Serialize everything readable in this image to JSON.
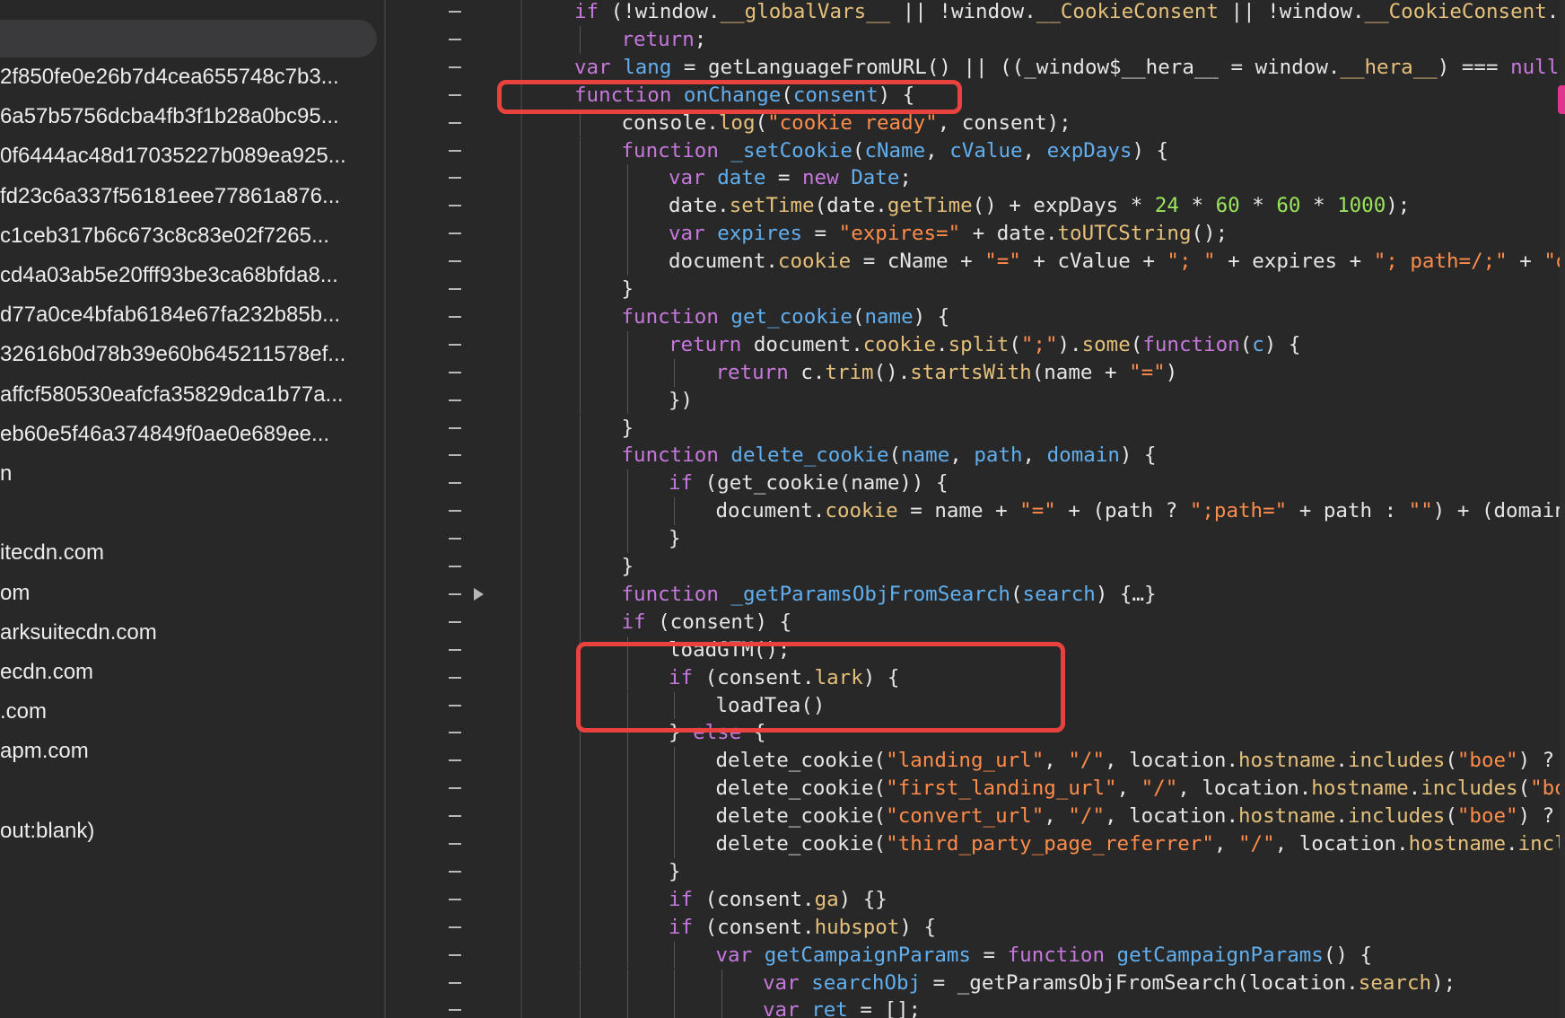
{
  "sidebar": {
    "items": [
      "2f850fe0e26b7d4cea655748c7b3...",
      "6a57b5756dcba4fb3f1b28a0bc95...",
      "0f6444ac48d17035227b089ea925...",
      "fd23c6a337f56181eee77861a876...",
      "c1ceb317b6c673c8c83e02f7265...",
      "cd4a03ab5e20fff93be3ca68bfda8...",
      "d77a0ce4bfab6184e67fa232b85b...",
      "32616b0d78b39e60b645211578ef...",
      "affcf580530eafcfa35829dca1b77a...",
      "eb60e5f46a374849f0ae0e689ee...",
      "n",
      "",
      "itecdn.com",
      "om",
      "arksuitecdn.com",
      "ecdn.com",
      ".com",
      "apm.com",
      "",
      "out:blank)"
    ]
  },
  "theme": {
    "keyword": "#c678dd",
    "function_name": "#61afef",
    "property": "#e5c07b",
    "string": "#ff8c4b",
    "number": "#9ae65c",
    "plain": "#e6e6e6",
    "highlight_box": "#e8423f",
    "scroll_marker": "#e0358f"
  },
  "code_lines": [
    {
      "indent": 0,
      "tokens": [
        [
          "if",
          "k"
        ],
        [
          " (!window.",
          "p"
        ],
        [
          "__globalVars__",
          "y"
        ],
        [
          " || !window.",
          "p"
        ],
        [
          "__CookieConsent",
          "y"
        ],
        [
          " || !window.",
          "p"
        ],
        [
          "__CookieConsent",
          "y"
        ],
        [
          ".",
          "p"
        ],
        [
          "ir",
          "y"
        ]
      ]
    },
    {
      "indent": 1,
      "tokens": [
        [
          "return",
          "k"
        ],
        [
          ";",
          "p"
        ]
      ]
    },
    {
      "indent": 0,
      "tokens": [
        [
          "var",
          "k"
        ],
        [
          " ",
          "p"
        ],
        [
          "lang",
          "f"
        ],
        [
          " = getLanguageFromURL() || ((_window$__hera__ = window.",
          "p"
        ],
        [
          "__hera__",
          "y"
        ],
        [
          ") === ",
          "p"
        ],
        [
          "null",
          "k"
        ],
        [
          " |",
          "p"
        ]
      ]
    },
    {
      "indent": 0,
      "tokens": [
        [
          "function",
          "k"
        ],
        [
          " ",
          "p"
        ],
        [
          "onChange",
          "f"
        ],
        [
          "(",
          "p"
        ],
        [
          "consent",
          "f"
        ],
        [
          ") {",
          "p"
        ]
      ]
    },
    {
      "indent": 1,
      "tokens": [
        [
          "console.",
          "p"
        ],
        [
          "log",
          "y"
        ],
        [
          "(",
          "p"
        ],
        [
          "\"cookie ready\"",
          "s"
        ],
        [
          ", consent);",
          "p"
        ]
      ]
    },
    {
      "indent": 1,
      "tokens": [
        [
          "function",
          "k"
        ],
        [
          " ",
          "p"
        ],
        [
          "_setCookie",
          "f"
        ],
        [
          "(",
          "p"
        ],
        [
          "cName",
          "f"
        ],
        [
          ", ",
          "p"
        ],
        [
          "cValue",
          "f"
        ],
        [
          ", ",
          "p"
        ],
        [
          "expDays",
          "f"
        ],
        [
          ") {",
          "p"
        ]
      ]
    },
    {
      "indent": 2,
      "tokens": [
        [
          "var",
          "k"
        ],
        [
          " ",
          "p"
        ],
        [
          "date",
          "f"
        ],
        [
          " = ",
          "p"
        ],
        [
          "new",
          "k"
        ],
        [
          " ",
          "p"
        ],
        [
          "Date",
          "f"
        ],
        [
          ";",
          "p"
        ]
      ]
    },
    {
      "indent": 2,
      "tokens": [
        [
          "date.",
          "p"
        ],
        [
          "setTime",
          "y"
        ],
        [
          "(date.",
          "p"
        ],
        [
          "getTime",
          "y"
        ],
        [
          "() + expDays * ",
          "p"
        ],
        [
          "24",
          "n"
        ],
        [
          " * ",
          "p"
        ],
        [
          "60",
          "n"
        ],
        [
          " * ",
          "p"
        ],
        [
          "60",
          "n"
        ],
        [
          " * ",
          "p"
        ],
        [
          "1000",
          "n"
        ],
        [
          ");",
          "p"
        ]
      ]
    },
    {
      "indent": 2,
      "tokens": [
        [
          "var",
          "k"
        ],
        [
          " ",
          "p"
        ],
        [
          "expires",
          "f"
        ],
        [
          " = ",
          "p"
        ],
        [
          "\"expires=\"",
          "s"
        ],
        [
          " + date.",
          "p"
        ],
        [
          "toUTCString",
          "y"
        ],
        [
          "();",
          "p"
        ]
      ]
    },
    {
      "indent": 2,
      "tokens": [
        [
          "document.",
          "p"
        ],
        [
          "cookie",
          "y"
        ],
        [
          " = cName + ",
          "p"
        ],
        [
          "\"=\"",
          "s"
        ],
        [
          " + cValue + ",
          "p"
        ],
        [
          "\"; \"",
          "s"
        ],
        [
          " + expires + ",
          "p"
        ],
        [
          "\"; path=/;\"",
          "s"
        ],
        [
          " + ",
          "p"
        ],
        [
          "\"do",
          "s"
        ]
      ]
    },
    {
      "indent": 1,
      "tokens": [
        [
          "}",
          "p"
        ]
      ]
    },
    {
      "indent": 1,
      "tokens": [
        [
          "function",
          "k"
        ],
        [
          " ",
          "p"
        ],
        [
          "get_cookie",
          "f"
        ],
        [
          "(",
          "p"
        ],
        [
          "name",
          "f"
        ],
        [
          ") {",
          "p"
        ]
      ]
    },
    {
      "indent": 2,
      "tokens": [
        [
          "return",
          "k"
        ],
        [
          " document.",
          "p"
        ],
        [
          "cookie",
          "y"
        ],
        [
          ".",
          "p"
        ],
        [
          "split",
          "y"
        ],
        [
          "(",
          "p"
        ],
        [
          "\";\"",
          "s"
        ],
        [
          ").",
          "p"
        ],
        [
          "some",
          "y"
        ],
        [
          "(",
          "p"
        ],
        [
          "function",
          "k"
        ],
        [
          "(",
          "p"
        ],
        [
          "c",
          "f"
        ],
        [
          ") {",
          "p"
        ]
      ]
    },
    {
      "indent": 3,
      "tokens": [
        [
          "return",
          "k"
        ],
        [
          " c.",
          "p"
        ],
        [
          "trim",
          "y"
        ],
        [
          "().",
          "p"
        ],
        [
          "startsWith",
          "y"
        ],
        [
          "(name + ",
          "p"
        ],
        [
          "\"=\"",
          "s"
        ],
        [
          ")",
          "p"
        ]
      ]
    },
    {
      "indent": 2,
      "tokens": [
        [
          "})",
          "p"
        ]
      ]
    },
    {
      "indent": 1,
      "tokens": [
        [
          "}",
          "p"
        ]
      ]
    },
    {
      "indent": 1,
      "tokens": [
        [
          "function",
          "k"
        ],
        [
          " ",
          "p"
        ],
        [
          "delete_cookie",
          "f"
        ],
        [
          "(",
          "p"
        ],
        [
          "name",
          "f"
        ],
        [
          ", ",
          "p"
        ],
        [
          "path",
          "f"
        ],
        [
          ", ",
          "p"
        ],
        [
          "domain",
          "f"
        ],
        [
          ") {",
          "p"
        ]
      ]
    },
    {
      "indent": 2,
      "tokens": [
        [
          "if",
          "k"
        ],
        [
          " (get_cookie(name)) {",
          "p"
        ]
      ]
    },
    {
      "indent": 3,
      "tokens": [
        [
          "document.",
          "p"
        ],
        [
          "cookie",
          "y"
        ],
        [
          " = name + ",
          "p"
        ],
        [
          "\"=\"",
          "s"
        ],
        [
          " + (path ? ",
          "p"
        ],
        [
          "\";path=\"",
          "s"
        ],
        [
          " + path : ",
          "p"
        ],
        [
          "\"\"",
          "s"
        ],
        [
          ") + (domain",
          "p"
        ]
      ]
    },
    {
      "indent": 2,
      "tokens": [
        [
          "}",
          "p"
        ]
      ]
    },
    {
      "indent": 1,
      "tokens": [
        [
          "}",
          "p"
        ]
      ]
    },
    {
      "indent": 1,
      "fold": true,
      "tokens": [
        [
          "function",
          "k"
        ],
        [
          " ",
          "p"
        ],
        [
          "_getParamsObjFromSearch",
          "f"
        ],
        [
          "(",
          "p"
        ],
        [
          "search",
          "f"
        ],
        [
          ") {…}",
          "p"
        ]
      ]
    },
    {
      "indent": 1,
      "tokens": [
        [
          "if",
          "k"
        ],
        [
          " (consent) {",
          "p"
        ]
      ]
    },
    {
      "indent": 2,
      "tokens": [
        [
          "loadGTM();",
          "p"
        ]
      ]
    },
    {
      "indent": 2,
      "tokens": [
        [
          "if",
          "k"
        ],
        [
          " (consent.",
          "p"
        ],
        [
          "lark",
          "y"
        ],
        [
          ") {",
          "p"
        ]
      ]
    },
    {
      "indent": 3,
      "tokens": [
        [
          "loadTea()",
          "p"
        ]
      ]
    },
    {
      "indent": 2,
      "tokens": [
        [
          "} ",
          "p"
        ],
        [
          "else",
          "k"
        ],
        [
          " {",
          "p"
        ]
      ]
    },
    {
      "indent": 3,
      "tokens": [
        [
          "delete_cookie(",
          "p"
        ],
        [
          "\"landing_url\"",
          "s"
        ],
        [
          ", ",
          "p"
        ],
        [
          "\"/\"",
          "s"
        ],
        [
          ", location.",
          "p"
        ],
        [
          "hostname",
          "y"
        ],
        [
          ".",
          "p"
        ],
        [
          "includes",
          "y"
        ],
        [
          "(",
          "p"
        ],
        [
          "\"boe\"",
          "s"
        ],
        [
          ") ? ",
          "p"
        ],
        [
          "\"",
          "s"
        ]
      ]
    },
    {
      "indent": 3,
      "tokens": [
        [
          "delete_cookie(",
          "p"
        ],
        [
          "\"first_landing_url\"",
          "s"
        ],
        [
          ", ",
          "p"
        ],
        [
          "\"/\"",
          "s"
        ],
        [
          ", location.",
          "p"
        ],
        [
          "hostname",
          "y"
        ],
        [
          ".",
          "p"
        ],
        [
          "includes",
          "y"
        ],
        [
          "(",
          "p"
        ],
        [
          "\"boe",
          "s"
        ]
      ]
    },
    {
      "indent": 3,
      "tokens": [
        [
          "delete_cookie(",
          "p"
        ],
        [
          "\"convert_url\"",
          "s"
        ],
        [
          ", ",
          "p"
        ],
        [
          "\"/\"",
          "s"
        ],
        [
          ", location.",
          "p"
        ],
        [
          "hostname",
          "y"
        ],
        [
          ".",
          "p"
        ],
        [
          "includes",
          "y"
        ],
        [
          "(",
          "p"
        ],
        [
          "\"boe\"",
          "s"
        ],
        [
          ") ? ",
          "p"
        ],
        [
          "\"",
          "s"
        ]
      ]
    },
    {
      "indent": 3,
      "tokens": [
        [
          "delete_cookie(",
          "p"
        ],
        [
          "\"third_party_page_referrer\"",
          "s"
        ],
        [
          ", ",
          "p"
        ],
        [
          "\"/\"",
          "s"
        ],
        [
          ", location.",
          "p"
        ],
        [
          "hostname",
          "y"
        ],
        [
          ".",
          "p"
        ],
        [
          "inclu",
          "y"
        ]
      ]
    },
    {
      "indent": 2,
      "tokens": [
        [
          "}",
          "p"
        ]
      ]
    },
    {
      "indent": 2,
      "tokens": [
        [
          "if",
          "k"
        ],
        [
          " (consent.",
          "p"
        ],
        [
          "ga",
          "y"
        ],
        [
          ") {}",
          "p"
        ]
      ]
    },
    {
      "indent": 2,
      "tokens": [
        [
          "if",
          "k"
        ],
        [
          " (consent.",
          "p"
        ],
        [
          "hubspot",
          "y"
        ],
        [
          ") {",
          "p"
        ]
      ]
    },
    {
      "indent": 3,
      "tokens": [
        [
          "var",
          "k"
        ],
        [
          " ",
          "p"
        ],
        [
          "getCampaignParams",
          "f"
        ],
        [
          " = ",
          "p"
        ],
        [
          "function",
          "k"
        ],
        [
          " ",
          "p"
        ],
        [
          "getCampaignParams",
          "f"
        ],
        [
          "() {",
          "p"
        ]
      ]
    },
    {
      "indent": 4,
      "tokens": [
        [
          "var",
          "k"
        ],
        [
          " ",
          "p"
        ],
        [
          "searchObj",
          "f"
        ],
        [
          " = _getParamsObjFromSearch(location.",
          "p"
        ],
        [
          "search",
          "y"
        ],
        [
          ");",
          "p"
        ]
      ]
    },
    {
      "indent": 4,
      "tokens": [
        [
          "var",
          "k"
        ],
        [
          " ",
          "p"
        ],
        [
          "ret",
          "f"
        ],
        [
          " = [];",
          "p"
        ]
      ]
    }
  ]
}
